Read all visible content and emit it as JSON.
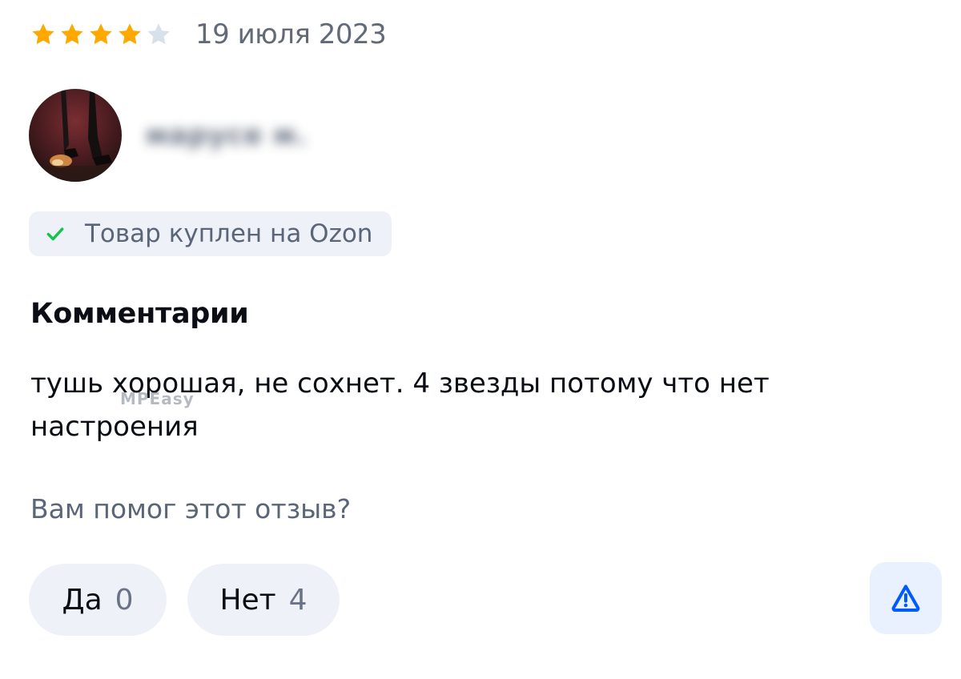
{
  "review": {
    "rating": 4,
    "rating_max": 5,
    "date": "19 июля 2023",
    "author_name": "марусе м."
  },
  "badge": {
    "icon": "check-icon",
    "text": "Товар куплен на Ozon"
  },
  "comments": {
    "title": "Комментарии",
    "text": "тушь хорошая, не сохнет. 4 звезды потому что нет настроения"
  },
  "watermark": "MPEasy",
  "helpful": {
    "question": "Вам помог этот отзыв?",
    "yes_label": "Да",
    "yes_count": "0",
    "no_label": "Нет",
    "no_count": "4"
  },
  "report": {
    "icon": "warning-icon"
  },
  "colors": {
    "star_filled": "#ffa800",
    "star_empty": "#d8e0ec",
    "check": "#10c44c",
    "accent": "#005bff",
    "button_bg": "#eef2f8"
  }
}
